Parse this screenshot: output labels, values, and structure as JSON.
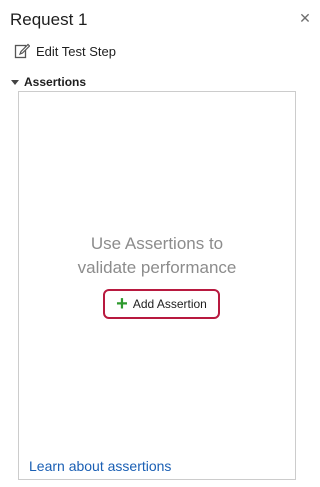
{
  "window": {
    "title": "Request 1",
    "close_glyph": "✕"
  },
  "toolbar": {
    "edit_label": "Edit Test Step",
    "edit_icon": "edit-document-icon"
  },
  "assertions": {
    "section_label": "Assertions",
    "empty_line1": "Use Assertions to",
    "empty_line2": "validate performance",
    "add_button_label": "Add Assertion",
    "add_glyph": "+",
    "learn_link": "Learn about assertions"
  },
  "colors": {
    "highlight_border": "#b8193f",
    "plus_green": "#2e9a2e",
    "link_blue": "#1a5fb4"
  }
}
